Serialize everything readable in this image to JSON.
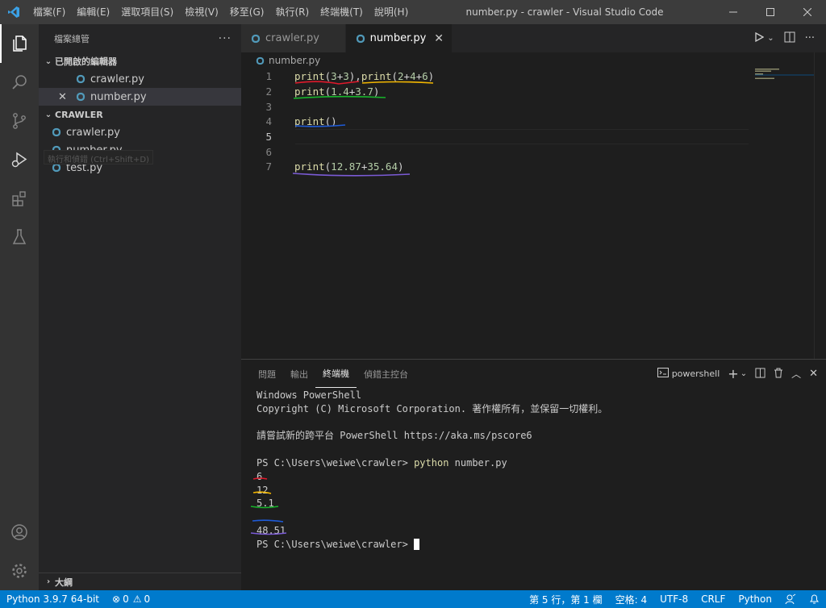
{
  "titlebar": {
    "menu": [
      "檔案(F)",
      "編輯(E)",
      "選取項目(S)",
      "檢視(V)",
      "移至(G)",
      "執行(R)",
      "終端機(T)",
      "說明(H)"
    ],
    "title": "number.py - crawler - Visual Studio Code"
  },
  "sidebar": {
    "header": "檔案總管",
    "open_editors_label": "已開啟的編輯器",
    "open_editors": [
      "crawler.py",
      "number.py"
    ],
    "folder_label": "CRAWLER",
    "files": [
      "crawler.py",
      "number.py",
      "test.py"
    ],
    "tooltip": "執行和偵錯 (Ctrl+Shift+D)",
    "outline_label": "大綱"
  },
  "tabs": [
    {
      "label": "crawler.py"
    },
    {
      "label": "number.py"
    }
  ],
  "breadcrumb": "number.py",
  "editor": {
    "line_numbers": [
      "1",
      "2",
      "3",
      "4",
      "5",
      "6",
      "7"
    ],
    "lines": [
      "print(3+3),print(2+4+6)",
      "print(1.4+3.7)",
      "",
      "print()",
      "",
      "",
      "print(12.87+35.64)"
    ]
  },
  "panel": {
    "tabs": [
      "問題",
      "輸出",
      "終端機",
      "偵錯主控台"
    ],
    "shell": "powershell",
    "terminal": [
      "Windows PowerShell",
      "Copyright (C) Microsoft Corporation. 著作權所有，並保留一切權利。",
      "",
      "請嘗試新的跨平台 PowerShell https://aka.ms/pscore6",
      "",
      "PS C:\\Users\\weiwe\\crawler> ",
      "6",
      "12",
      "5.1",
      "",
      "48.51",
      "PS C:\\Users\\weiwe\\crawler> "
    ],
    "command": "python",
    "command_args": " number.py"
  },
  "statusbar": {
    "python": "Python 3.9.7 64-bit",
    "errors": "0",
    "warnings": "0",
    "position": "第 5 行，第 1 欄",
    "spaces": "空格: 4",
    "encoding": "UTF-8",
    "eol": "CRLF",
    "language": "Python"
  },
  "colors": {
    "accent": "#007acc",
    "annotation_red": "#e0192b",
    "annotation_yellow": "#f2b600",
    "annotation_green": "#16b52a",
    "annotation_blue": "#1e5bd8",
    "annotation_purple": "#7b5bd6"
  }
}
